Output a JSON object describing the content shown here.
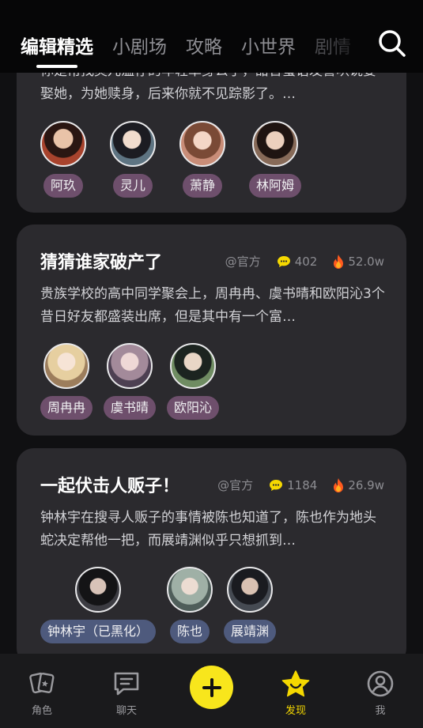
{
  "top_tabs": [
    "编辑精选",
    "小剧场",
    "攻略",
    "小世界",
    "剧情"
  ],
  "cards": [
    {
      "desc": "你是常找灵儿温存的年轻草身公子，甜言蜜语发誓哄说要娶她，为她赎身，后来你就不见踪影了。…",
      "characters": [
        {
          "name": "阿玖",
          "avatar": "avatar-ajiu"
        },
        {
          "name": "灵儿",
          "avatar": "avatar-linger"
        },
        {
          "name": "萧静",
          "avatar": "avatar-xiaojing"
        },
        {
          "name": "林阿姆",
          "avatar": "avatar-linamu"
        }
      ]
    },
    {
      "title": "猜猜谁家破产了",
      "author": "@官方",
      "comments": "402",
      "hot": "52.0w",
      "desc": "贵族学校的高中同学聚会上，周冉冉、虞书晴和欧阳沁3个昔日好友都盛装出席，但是其中有一个富…",
      "characters": [
        {
          "name": "周冉冉",
          "avatar": "avatar-zhouranran"
        },
        {
          "name": "虞书晴",
          "avatar": "avatar-yushuqing"
        },
        {
          "name": "欧阳沁",
          "avatar": "avatar-ouyangqin"
        }
      ]
    },
    {
      "title": "一起伏击人贩子！",
      "author": "@官方",
      "comments": "1184",
      "hot": "26.9w",
      "desc": "钟林宇在搜寻人贩子的事情被陈也知道了，陈也作为地头蛇决定帮他一把，而展靖渊似乎只想抓到…",
      "characters": [
        {
          "name": "钟林宇（已黑化）",
          "avatar": "avatar-zhonglinyu"
        },
        {
          "name": "陈也",
          "avatar": "avatar-chenye"
        },
        {
          "name": "展靖渊",
          "avatar": "avatar-zhanjingyuan"
        }
      ]
    }
  ],
  "bottom_nav": [
    {
      "label": "角色",
      "icon": "cards-icon"
    },
    {
      "label": "聊天",
      "icon": "chat-icon"
    },
    {
      "label": "",
      "icon": "plus-icon"
    },
    {
      "label": "发现",
      "icon": "star-icon"
    },
    {
      "label": "我",
      "icon": "profile-icon"
    }
  ],
  "colors": {
    "background": "#101012",
    "card": "#2b2a2e",
    "accent_yellow": "#f8e61c",
    "active_nav": "#f5d800",
    "pill_pink": "#6e4f6c",
    "pill_blue": "#4e5a7d"
  }
}
